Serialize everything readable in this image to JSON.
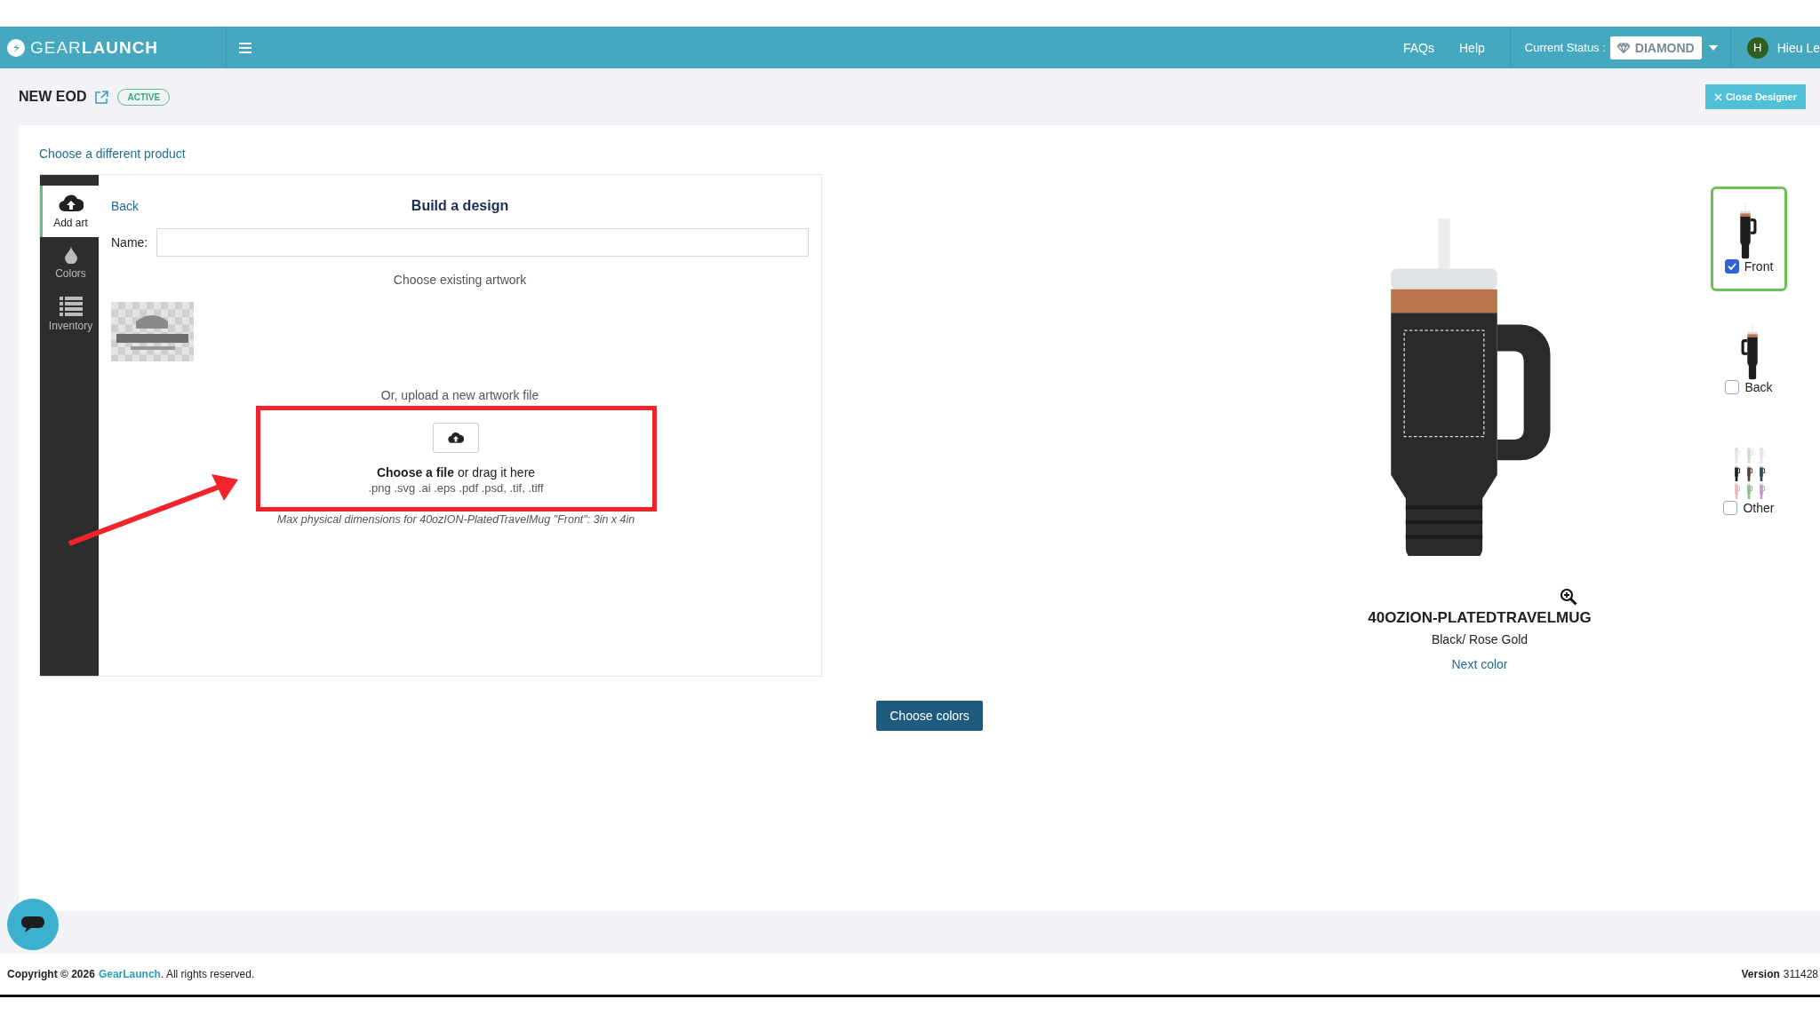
{
  "header": {
    "logo": "GEAR**LAUNCH**",
    "nav": [
      "FAQs",
      "Help"
    ],
    "status_label": "Current Status :",
    "status_value": "DIAMOND",
    "user": {
      "initial": "H",
      "name": "Hieu Le"
    }
  },
  "page": {
    "title": "NEW EOD",
    "status_badge": "ACTIVE",
    "close_button": "Close Designer"
  },
  "choose_product_link": "Choose a different product",
  "sidebar": {
    "tabs": [
      {
        "label": "Add art",
        "kind": "upload",
        "selected": true
      },
      {
        "label": "Colors",
        "kind": "drop",
        "selected": false
      },
      {
        "label": "Inventory",
        "kind": "list",
        "selected": false
      }
    ]
  },
  "designer": {
    "back_link": "Back",
    "heading": "Build a design",
    "name_label": "Name:",
    "existing_label": "Choose existing artwork",
    "upload_label": "Or, upload a new artwork file",
    "dropzone": {
      "prompt": "**Choose a file** or drag it here",
      "formats": ".png .svg .ai .eps .pdf .psd, .tif, .tiff"
    },
    "note": "Max physical dimensions for 40ozION-PlatedTravelMug \"Front\": 3in x 4in"
  },
  "preview": {
    "product": "40OZION-PLATEDTRAVELMUG",
    "variant": "Black/ Rose Gold",
    "next_color": "Next color"
  },
  "views": [
    {
      "label": "Front",
      "kind": "front",
      "checked": true,
      "selected": true
    },
    {
      "label": "Back",
      "kind": "back",
      "checked": false,
      "selected": false
    },
    {
      "label": "Other",
      "kind": "other",
      "checked": false,
      "selected": false
    }
  ],
  "choose_colors_button": "Choose colors",
  "footer": {
    "copyright": "Copyright © 2026",
    "link": "GearLaunch",
    "rights": ". All rights reserved.",
    "version_label": "Version",
    "version": "311428"
  }
}
